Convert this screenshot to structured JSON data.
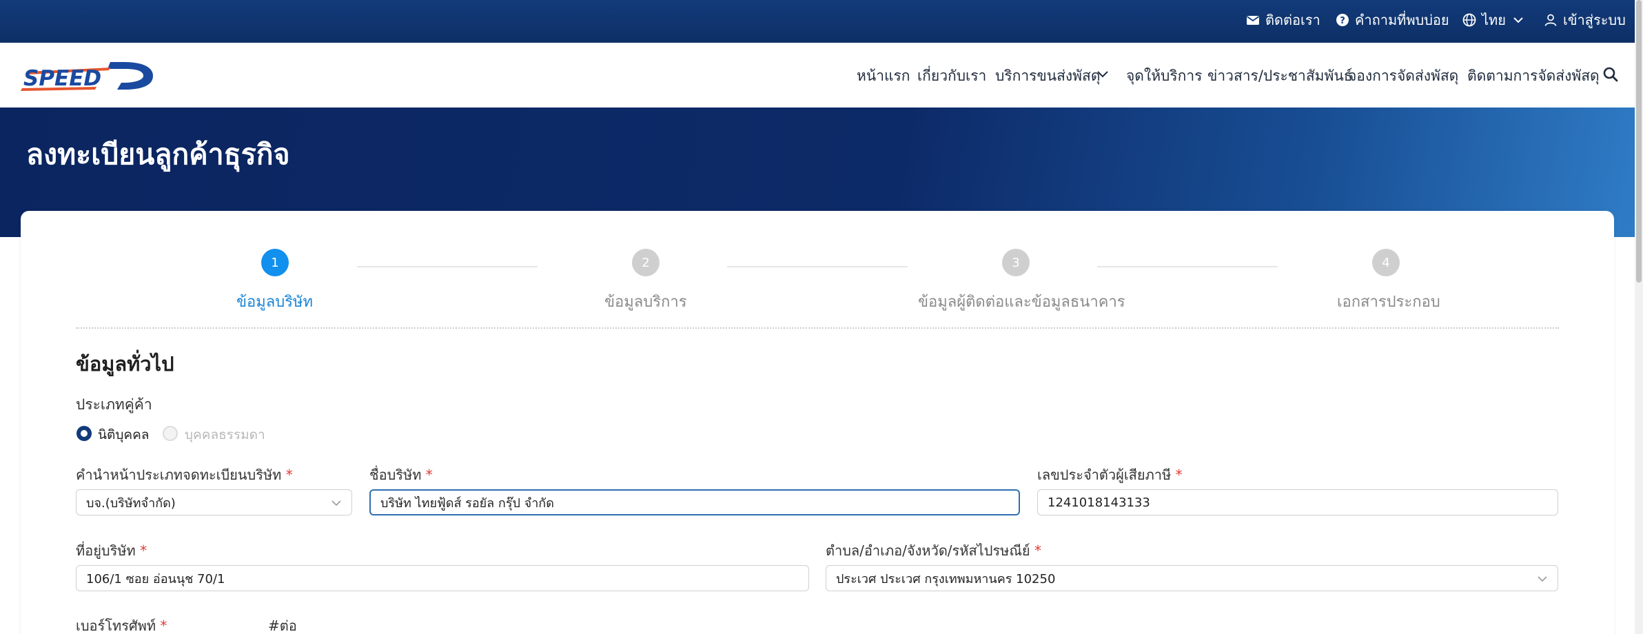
{
  "topbar": {
    "contact": "ติดต่อเรา",
    "faq": "คำถามที่พบบ่อย",
    "language": "ไทย",
    "login": "เข้าสู่ระบบ"
  },
  "nav": {
    "home": "หน้าแรก",
    "about": "เกี่ยวกับเรา",
    "services": "บริการขนส่งพัสดุ",
    "service_points": "จุดให้บริการ",
    "news": "ข่าวสาร/ประชาสัมพันธ์",
    "booking": "จองการจัดส่งพัสดุ",
    "tracking": "ติดตามการจัดส่งพัสดุ"
  },
  "hero": {
    "title": "ลงทะเบียนลูกค้าธุรกิจ"
  },
  "steps": [
    {
      "number": "1",
      "label": "ข้อมูลบริษัท",
      "state": "active"
    },
    {
      "number": "2",
      "label": "ข้อมูลบริการ",
      "state": "inactive"
    },
    {
      "number": "3",
      "label": "ข้อมูลผู้ติดต่อและข้อมูลธนาคาร",
      "state": "inactive"
    },
    {
      "number": "4",
      "label": "เอกสารประกอบ",
      "state": "inactive"
    }
  ],
  "form": {
    "section_title": "ข้อมูลทั่วไป",
    "partner_type_label": "ประเภทคู่ค้า",
    "partner_type_options": [
      "นิติบุคคล",
      "บุคคลธรรมดา"
    ],
    "partner_type_selected": "นิติบุคคล",
    "company_prefix_label": "คำนำหน้าประเภทจดทะเบียนบริษัท",
    "company_prefix_value": "บจ.(บริษัทจำกัด)",
    "company_name_label": "ชื่อบริษัท",
    "company_name_value": "บริษัท ไทยฟู้ดส์ รอยัล กรุ๊ป จำกัด",
    "tax_id_label": "เลขประจำตัวผู้เสียภาษี",
    "tax_id_value": "1241018143133",
    "address_label": "ที่อยู่บริษัท",
    "address_value": "106/1 ซอย อ่อนนุช 70/1",
    "subdistrict_label": "ตำบล/อำเภอ/จังหวัด/รหัสไปรษณีย์",
    "subdistrict_value": "ประเวศ ประเวศ กรุงเทพมหานคร 10250",
    "phone_label": "เบอร์โทรศัพท์",
    "ext_label": "#ต่อ",
    "required_mark": "*"
  },
  "colors": {
    "topbar": "#123b7a",
    "hero": "#0b2560",
    "active_step": "#1190ee",
    "required": "#e53935"
  }
}
